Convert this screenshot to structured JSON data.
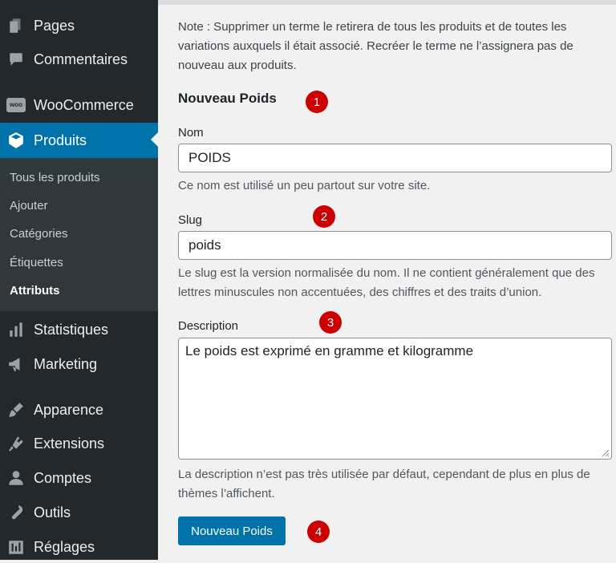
{
  "sidebar": {
    "items": [
      {
        "label": "Pages",
        "icon": "pages-icon"
      },
      {
        "label": "Commentaires",
        "icon": "comments-icon"
      },
      {
        "label": "WooCommerce",
        "icon": "woocommerce-icon"
      },
      {
        "label": "Produits",
        "icon": "products-icon"
      },
      {
        "label": "Statistiques",
        "icon": "stats-icon"
      },
      {
        "label": "Marketing",
        "icon": "megaphone-icon"
      },
      {
        "label": "Apparence",
        "icon": "brush-icon"
      },
      {
        "label": "Extensions",
        "icon": "plugin-icon"
      },
      {
        "label": "Comptes",
        "icon": "user-icon"
      },
      {
        "label": "Outils",
        "icon": "wrench-icon"
      },
      {
        "label": "Réglages",
        "icon": "settings-icon"
      }
    ],
    "submenu": [
      "Tous les produits",
      "Ajouter",
      "Catégories",
      "Étiquettes",
      "Attributs"
    ],
    "woo_badge": "woo"
  },
  "main": {
    "note": "Note : Supprimer un terme le retirera de tous les produits et de toutes les variations auxquels il était associé. Recréer le terme ne l’assignera pas de nouveau aux produits.",
    "heading": "Nouveau Poids",
    "name_label": "Nom",
    "name_value": "POIDS",
    "name_help": "Ce nom est utilisé un peu partout sur votre site.",
    "slug_label": "Slug",
    "slug_value": "poids",
    "slug_help": "Le slug est la version normalisée du nom. Il ne contient généralement que des lettres minuscules non accentuées, des chiffres et des traits d’union.",
    "desc_label": "Description",
    "desc_value": "Le poids est exprimé en gramme et kilogramme",
    "desc_help": "La description n’est pas très utilisée par défaut, cependant de plus en plus de thèmes l’affichent.",
    "submit_label": "Nouveau Poids"
  },
  "badges": [
    "1",
    "2",
    "3",
    "4"
  ],
  "colors": {
    "accent": "#0073aa",
    "sidebar": "#23282d",
    "badge": "#cc0000"
  }
}
